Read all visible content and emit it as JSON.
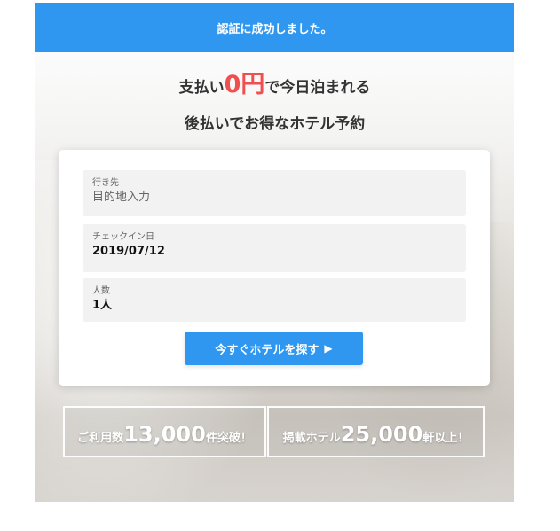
{
  "banner": {
    "message": "認証に成功しました。"
  },
  "headline": {
    "line1_prefix": "支払い",
    "line1_price": "0円",
    "line1_suffix": "で今日泊まれる",
    "line2": "後払いでお得なホテル予約"
  },
  "search_form": {
    "destination": {
      "label": "行き先",
      "placeholder": "目的地入力",
      "value": ""
    },
    "checkin": {
      "label": "チェックイン日",
      "value": "2019/07/12"
    },
    "guests": {
      "label": "人数",
      "value": "1人"
    },
    "submit_label": "今すぐホテルを探す",
    "submit_icon": "play-icon"
  },
  "stats": [
    {
      "prefix": "ご利用数",
      "number": "13,000",
      "suffix": "件突破！"
    },
    {
      "prefix": "掲載ホテル",
      "number": "25,000",
      "suffix": "軒以上！"
    }
  ],
  "colors": {
    "accent": "#2f97ef",
    "price": "#f04f4f",
    "text": "#333333"
  }
}
